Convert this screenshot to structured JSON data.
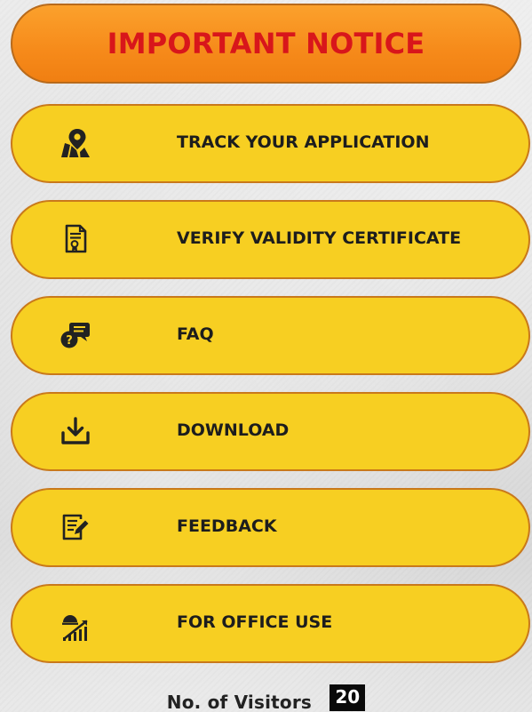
{
  "notice": {
    "label": "IMPORTANT NOTICE",
    "bg_color": "#f68a1a",
    "text_color": "#d8161b"
  },
  "menu": {
    "bg_color": "#f7cf22",
    "border_color": "#c9791b",
    "items": [
      {
        "label": "TRACK YOUR APPLICATION",
        "icon": "map-location-icon"
      },
      {
        "label": "VERIFY VALIDITY CERTIFICATE",
        "icon": "certificate-document-icon"
      },
      {
        "label": "FAQ",
        "icon": "faq-chat-icon"
      },
      {
        "label": "DOWNLOAD",
        "icon": "download-icon"
      },
      {
        "label": "FEEDBACK",
        "icon": "feedback-edit-icon"
      },
      {
        "label": "FOR OFFICE USE",
        "icon": "office-stats-icon"
      }
    ]
  },
  "visitors": {
    "label": "No. of Visitors",
    "count": "20"
  }
}
